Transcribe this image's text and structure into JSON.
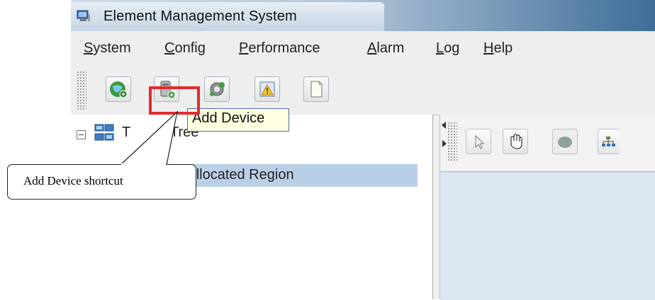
{
  "window": {
    "title": "Element Management System"
  },
  "menu": {
    "items": [
      {
        "mnemonic": "S",
        "rest": "ystem"
      },
      {
        "mnemonic": "C",
        "rest": "onfig"
      },
      {
        "mnemonic": "P",
        "rest": "erformance"
      },
      {
        "mnemonic": "A",
        "rest": "larm"
      },
      {
        "mnemonic": "L",
        "rest": "og"
      },
      {
        "mnemonic": "H",
        "rest": "elp"
      }
    ]
  },
  "toolbar": {
    "buttons": [
      {
        "icon": "globe-add-icon"
      },
      {
        "icon": "add-device-icon"
      },
      {
        "icon": "settings-gear-icon"
      },
      {
        "icon": "alarm-warning-icon"
      },
      {
        "icon": "document-icon"
      }
    ],
    "tooltip": "Add Device"
  },
  "tree": {
    "root_label": "Topo Tree",
    "root_visible": "T",
    "root_suffix": "Tree",
    "child_label": "Unallocated Region"
  },
  "right_toolbar": {
    "buttons": [
      {
        "icon": "select-pointer-icon"
      },
      {
        "icon": "pan-hand-icon"
      },
      {
        "icon": "device-blob-icon"
      },
      {
        "icon": "topology-layout-icon"
      }
    ]
  },
  "annotation": {
    "text": "Add Device shortcut",
    "highlight_color": "#e32b2b"
  }
}
